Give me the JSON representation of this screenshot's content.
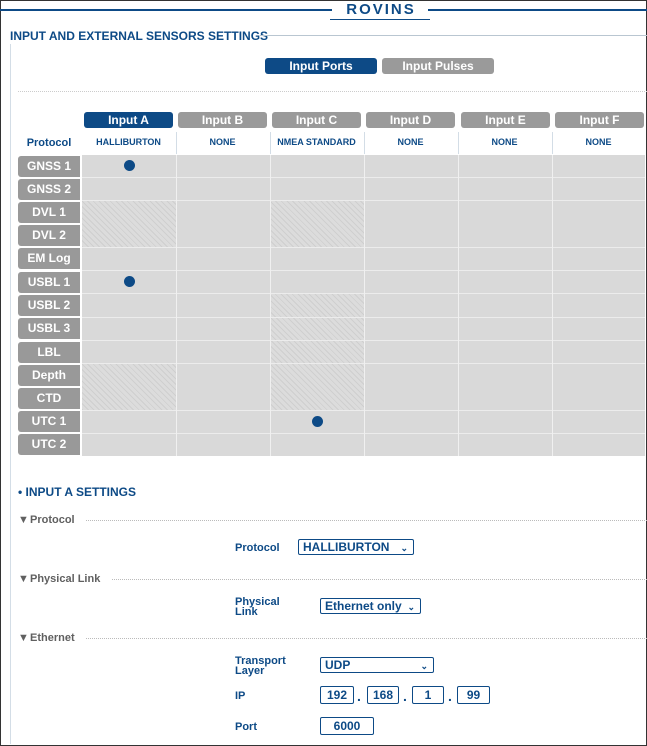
{
  "brand": "ROVINS",
  "section_title": "INPUT AND EXTERNAL SENSORS SETTINGS",
  "tabs": [
    {
      "label": "Input Ports",
      "active": true
    },
    {
      "label": "Input Pulses",
      "active": false
    }
  ],
  "inputs": [
    {
      "label": "Input A",
      "protocol": "HALLIBURTON",
      "active": true
    },
    {
      "label": "Input B",
      "protocol": "NONE",
      "active": false
    },
    {
      "label": "Input C",
      "protocol": "NMEA STANDARD",
      "active": false
    },
    {
      "label": "Input D",
      "protocol": "NONE",
      "active": false
    },
    {
      "label": "Input E",
      "protocol": "NONE",
      "active": false
    },
    {
      "label": "Input F",
      "protocol": "NONE",
      "active": false
    }
  ],
  "protocol_row_label": "Protocol",
  "sensors": [
    {
      "label": "GNSS 1",
      "selected_input": "Input A"
    },
    {
      "label": "GNSS 2",
      "selected_input": null
    },
    {
      "label": "DVL 1",
      "selected_input": null
    },
    {
      "label": "DVL 2",
      "selected_input": null
    },
    {
      "label": "EM Log",
      "selected_input": null
    },
    {
      "label": "USBL 1",
      "selected_input": "Input A"
    },
    {
      "label": "USBL 2",
      "selected_input": null
    },
    {
      "label": "USBL 3",
      "selected_input": null
    },
    {
      "label": "LBL",
      "selected_input": null
    },
    {
      "label": "Depth",
      "selected_input": null
    },
    {
      "label": "CTD",
      "selected_input": null
    },
    {
      "label": "UTC 1",
      "selected_input": "Input C"
    },
    {
      "label": "UTC 2",
      "selected_input": null
    }
  ],
  "input_settings": {
    "title": "• INPUT A SETTINGS",
    "protocol_group": {
      "title": "Protocol",
      "field_label": "Protocol",
      "value": "HALLIBURTON"
    },
    "physical_link_group": {
      "title": "Physical Link",
      "field_label": "Physical Link",
      "value": "Ethernet only"
    },
    "ethernet_group": {
      "title": "Ethernet",
      "transport_label": "Transport Layer",
      "transport_value": "UDP",
      "ip_label": "IP",
      "ip_octets": [
        "192",
        "168",
        "1",
        "99"
      ],
      "port_label": "Port",
      "port_value": "6000"
    }
  },
  "colors": {
    "accent": "#0d4a86",
    "inactive": "#9a9a9a",
    "grid_bg": "#d9d9d9"
  },
  "icons": {
    "collapse": "triangle-down-icon",
    "dropdown": "chevron-down-icon"
  }
}
